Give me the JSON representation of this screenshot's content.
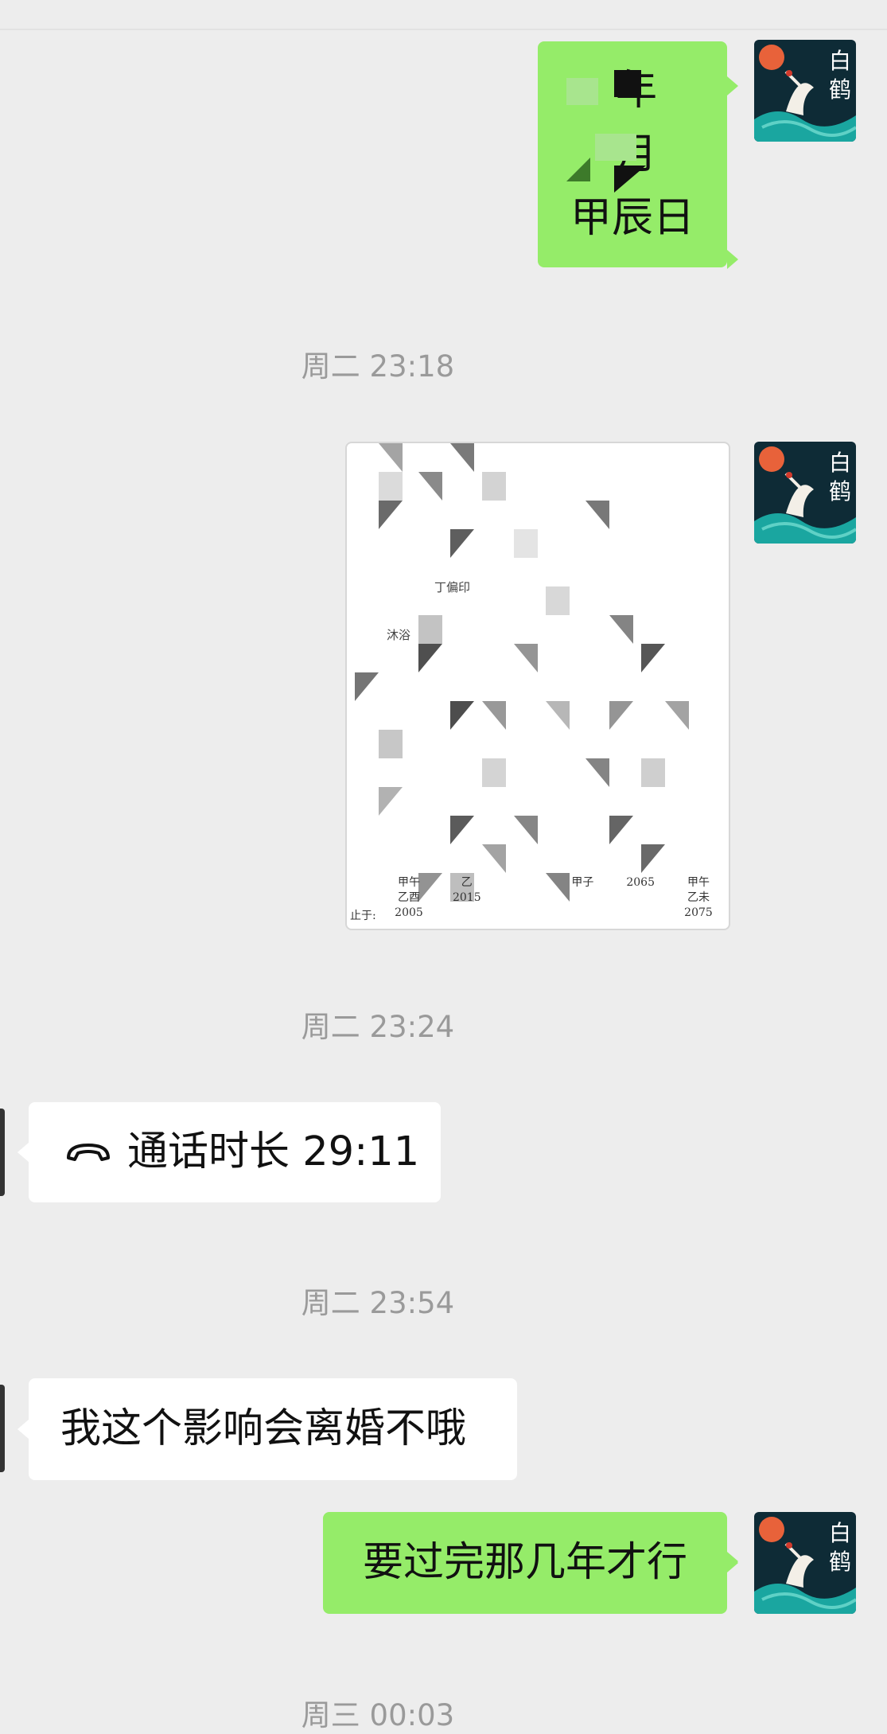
{
  "messages": {
    "m1": {
      "lines": [
        "年",
        "月",
        "甲辰日"
      ]
    },
    "t1": "周二 23:18",
    "img": {
      "caption_row": "丁偏印",
      "side_label": "沐浴",
      "bottom": {
        "prefix": "止于:",
        "cells": [
          {
            "stem": "甲午",
            "branch": "乙酉",
            "year": "2005"
          },
          {
            "stem": "",
            "branch": "乙",
            "year": "2015"
          },
          {
            "stem": "",
            "branch": "",
            "year": ""
          },
          {
            "stem": "甲子",
            "branch": "",
            "year": ""
          },
          {
            "stem": "",
            "branch": "",
            "year": "2065"
          },
          {
            "stem": "甲午",
            "branch": "乙未",
            "year": "2075"
          }
        ]
      }
    },
    "t2": "周二 23:24",
    "call": {
      "label": "通话时长 29:11"
    },
    "t3": "周二 23:54",
    "q": {
      "text": "我这个影响会离婚不哦"
    },
    "a": {
      "text": "要过完那几年才行"
    },
    "t4": "周三 00:03"
  },
  "avatar": {
    "title_chars": [
      "白",
      "鹤"
    ]
  },
  "colors": {
    "bg": "#ededed",
    "me_bubble": "#95ec69",
    "other_bubble": "#ffffff",
    "time_text": "#9a9a9a"
  }
}
